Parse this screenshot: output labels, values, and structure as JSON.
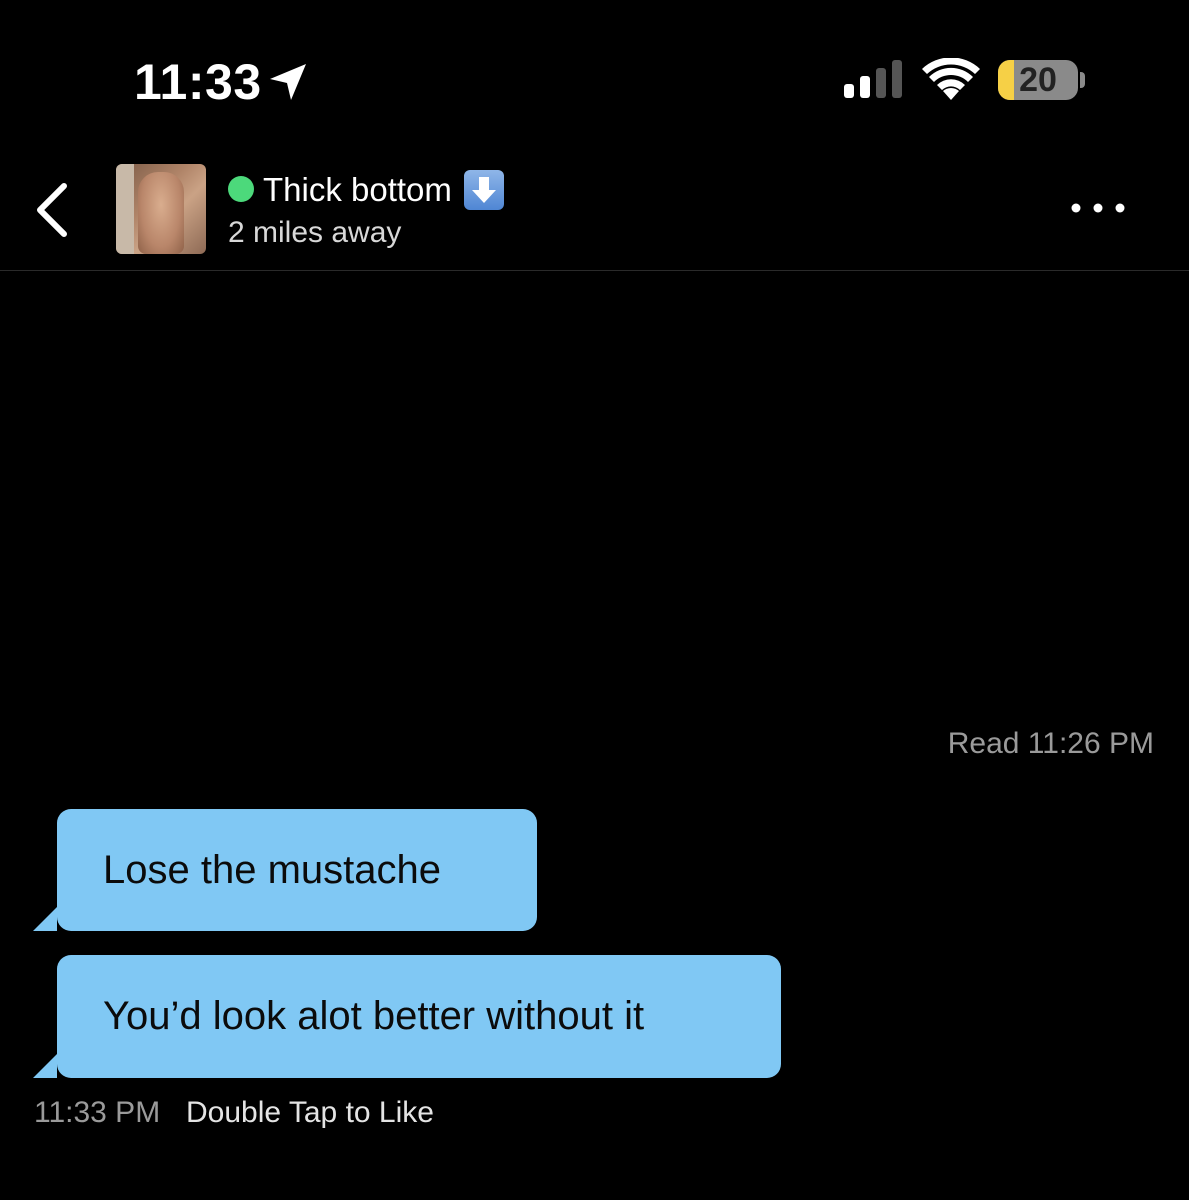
{
  "status_bar": {
    "time": "11:33",
    "battery_percent": "20",
    "battery_level": 0.2,
    "battery_color": "#f6d046",
    "signal_bars_active": 2,
    "signal_bars_total": 4,
    "icons": [
      "location-arrow-icon",
      "cellular-signal-icon",
      "wifi-icon",
      "battery-icon"
    ]
  },
  "header": {
    "contact_name": "Thick bottom",
    "name_emoji": "down-arrow-emoji",
    "online_color": "#4cd97b",
    "distance": "2 miles away",
    "icons": [
      "chevron-left-icon",
      "more-dots-icon"
    ]
  },
  "chat": {
    "read_receipt": "Read 11:26 PM",
    "bubble_color": "#80c8f4",
    "messages": [
      {
        "text": "Lose the mustache"
      },
      {
        "text": "You’d look alot better without it"
      }
    ],
    "last_message_time": "11:33 PM",
    "like_hint": "Double Tap to Like"
  }
}
